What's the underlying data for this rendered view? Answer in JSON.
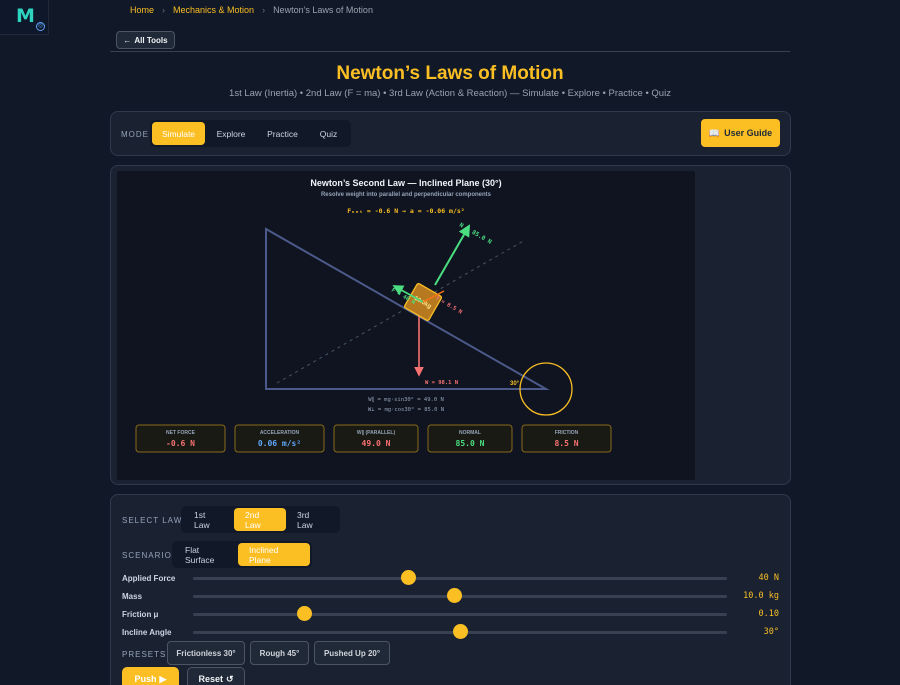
{
  "app": {
    "logo_letter": "M"
  },
  "breadcrumb": {
    "home": "Home",
    "section": "Mechanics & Motion",
    "current": "Newton’s Laws of Motion",
    "sep": "›"
  },
  "nav": {
    "all_tools": "All Tools",
    "back_icon": "←"
  },
  "header": {
    "title": "Newton’s Laws of Motion",
    "subtitle": "1st Law (Inertia) • 2nd Law (F = ma) • 3rd Law (Action & Reaction) — Simulate • Explore • Practice • Quiz"
  },
  "mode": {
    "label": "MODE",
    "tabs": [
      "Simulate",
      "Explore",
      "Practice",
      "Quiz"
    ],
    "active": "Simulate",
    "guide_icon": "📖",
    "guide_label": "User Guide"
  },
  "simulation": {
    "title": "Newton’s Second Law — Inclined Plane (30°)",
    "subtitle": "Resolve weight into parallel and perpendicular components",
    "fnet_line": "Fₙₑₜ = -0.6 N → a = -0.06 m/s²",
    "normal_label": "N = 85.0 N",
    "friction_label": "f = 8.5 N",
    "applied_label": "F = 40 N",
    "block_label": "10.0kg",
    "weight_label": "W = 98.1 N",
    "angle_label": "30°",
    "parallel_eq": "W∥ = mg·sin30° = 49.0 N",
    "perp_eq": "W⊥ = mg·cos30° = 85.0 N",
    "readouts": [
      {
        "label": "NET FORCE",
        "value": "-0.6 N",
        "color": "#f87171"
      },
      {
        "label": "ACCELERATION",
        "value": "0.06 m/s²",
        "color": "#60a5fa"
      },
      {
        "label": "W∥ (PARALLEL)",
        "value": "49.0 N",
        "color": "#f87171"
      },
      {
        "label": "NORMAL",
        "value": "85.0 N",
        "color": "#4ade80"
      },
      {
        "label": "FRICTION",
        "value": "8.5 N",
        "color": "#f87171"
      }
    ],
    "incline_angle_deg": 30
  },
  "controls": {
    "law_label": "SELECT LAW",
    "laws": [
      "1st Law",
      "2nd Law",
      "3rd Law"
    ],
    "active_law": "2nd Law",
    "scenario_label": "SCENARIO",
    "scenarios": [
      "Flat Surface",
      "Inclined Plane"
    ],
    "active_scenario": "Inclined Plane",
    "sliders": [
      {
        "label": "Applied Force",
        "value": "40 N",
        "fraction": 0.4
      },
      {
        "label": "Mass",
        "value": "10.0 kg",
        "fraction": 0.49
      },
      {
        "label": "Friction μ",
        "value": "0.10",
        "fraction": 0.21
      },
      {
        "label": "Incline Angle",
        "value": "30°",
        "fraction": 0.5
      }
    ],
    "presets_label": "PRESETS",
    "presets": [
      "Frictionless 30°",
      "Rough 45°",
      "Pushed Up 20°"
    ],
    "push_label": "Push",
    "push_icon": "▶",
    "reset_label": "Reset",
    "reset_icon": "↺"
  },
  "colors": {
    "accent": "#fbbf24",
    "force_normal": "#4ade80",
    "force_weight": "#f87171",
    "incline": "#4b5a8a"
  }
}
